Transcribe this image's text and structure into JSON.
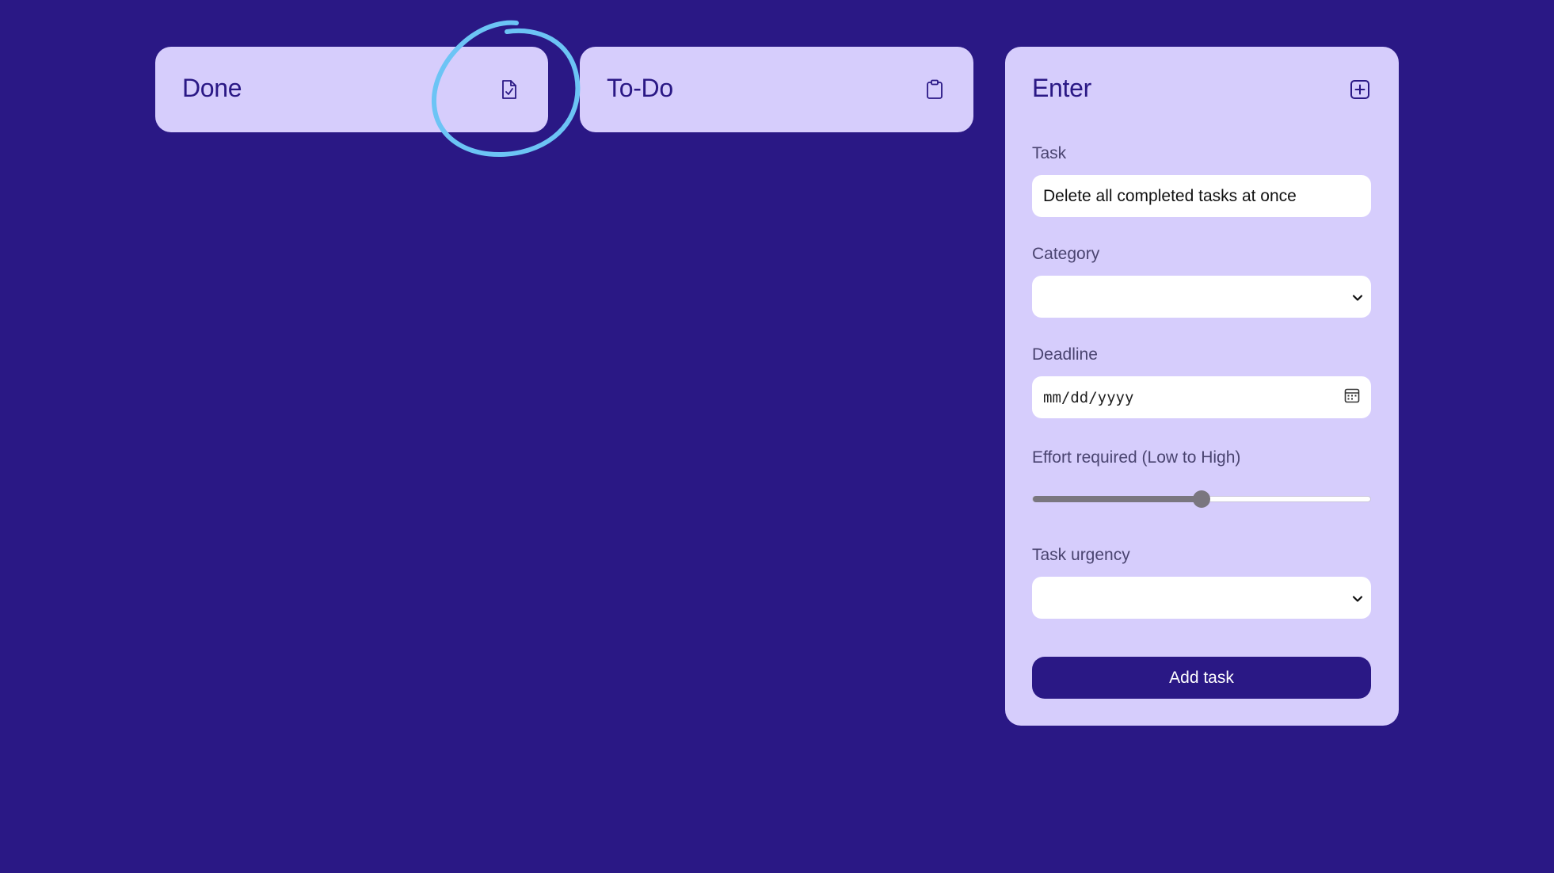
{
  "columns": {
    "done": {
      "title": "Done",
      "icon": "file-check-icon"
    },
    "todo": {
      "title": "To-Do",
      "icon": "clipboard-icon"
    }
  },
  "enter": {
    "title": "Enter",
    "icon": "plus-square-icon",
    "task": {
      "label": "Task",
      "value": "Delete all completed tasks at once"
    },
    "category": {
      "label": "Category",
      "value": "",
      "icon": "chevron-down-icon"
    },
    "deadline": {
      "label": "Deadline",
      "placeholder": "mm/dd/yyyy",
      "icon": "calendar-icon"
    },
    "effort": {
      "label": "Effort required (Low to High)",
      "level": 0.5
    },
    "urgency": {
      "label": "Task urgency",
      "value": "",
      "icon": "chevron-down-icon"
    },
    "submit_label": "Add task"
  },
  "colors": {
    "background": "#2a1885",
    "card": "#d6cdfc",
    "accent": "#2a1885",
    "annotation": "#6cc4f5"
  }
}
